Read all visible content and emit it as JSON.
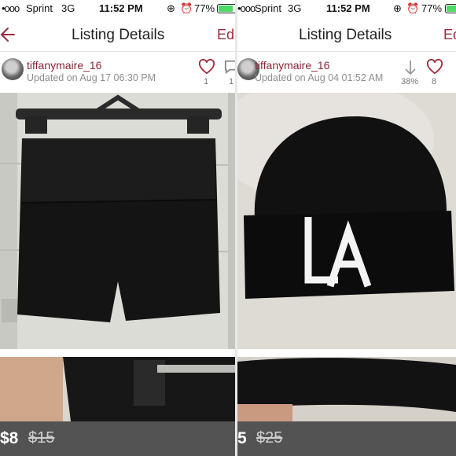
{
  "colors": {
    "accent": "#9b2c3d",
    "battery": "#4cd964"
  },
  "left": {
    "status": {
      "signal": "•ooo",
      "carrier": "Sprint",
      "network": "3G",
      "time": "11:52 PM",
      "battery": "77%"
    },
    "nav": {
      "title": "Listing Details",
      "edit": "Edi"
    },
    "listing": {
      "username": "tiffanymaire_16",
      "updated": "Updated on Aug 17 06:30 PM",
      "likes": "1",
      "comments": "1"
    },
    "price": {
      "current": "$8",
      "original": "$15"
    }
  },
  "right": {
    "status": {
      "signal": "•ooo",
      "carrier": "Sprint",
      "network": "3G",
      "time": "11:52 PM",
      "battery": "77%"
    },
    "nav": {
      "title": "Listing Details",
      "edit": "Ed"
    },
    "listing": {
      "username": "tiffanymaire_16",
      "updated": "Updated on Aug 04 01:52 AM",
      "price_drop": "38%",
      "likes": "8"
    },
    "price": {
      "current": "5",
      "original": "$25"
    }
  }
}
